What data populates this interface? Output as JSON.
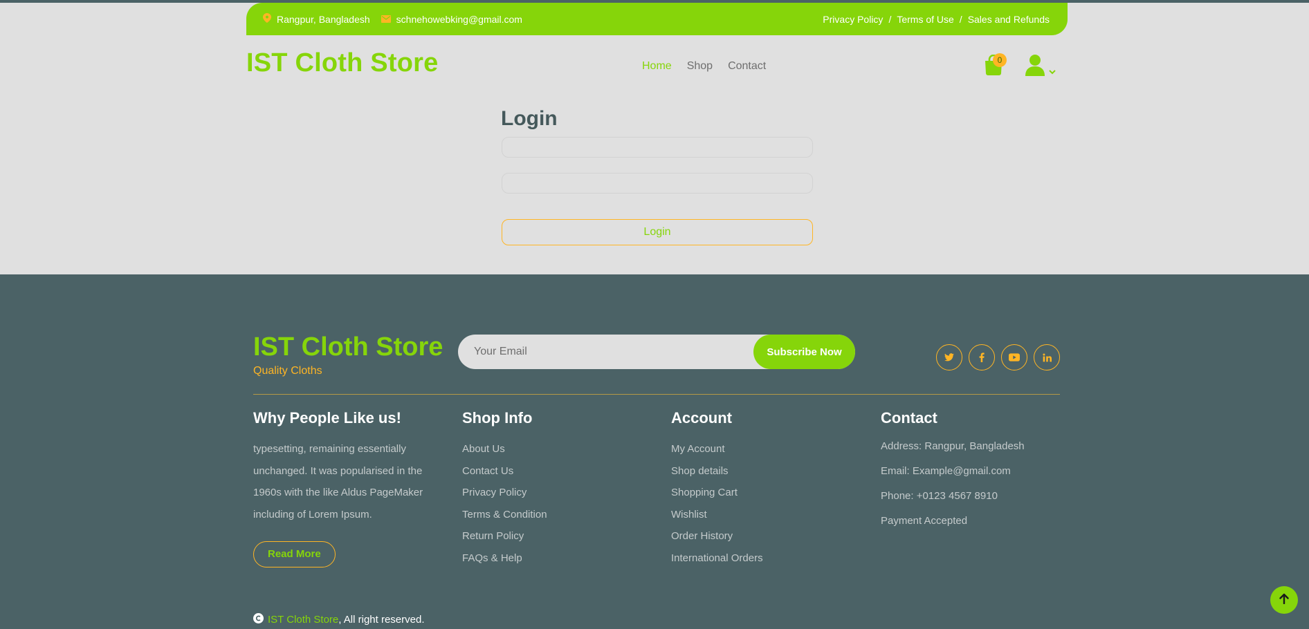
{
  "topbar": {
    "location": "Rangpur, Bangladesh",
    "email": "schnehowebking@gmail.com",
    "links": [
      "Privacy Policy",
      "Terms of Use",
      "Sales and Refunds"
    ],
    "separator": "/"
  },
  "header": {
    "brand": "IST Cloth Store",
    "nav": [
      "Home",
      "Shop",
      "Contact"
    ],
    "active_nav": "Home",
    "cart_count": "0",
    "icons": [
      "map-pin-icon",
      "envelope-icon",
      "shopping-bag-icon",
      "user-icon",
      "chevron-down-icon"
    ]
  },
  "login": {
    "title": "Login",
    "submit_label": "Login"
  },
  "footer": {
    "brand": "IST Cloth Store",
    "tagline": "Quality Cloths",
    "subscribe": {
      "placeholder": "Your Email",
      "button_label": "Subscribe Now"
    },
    "social_icons": [
      "twitter-icon",
      "facebook-icon",
      "youtube-icon",
      "linkedin-icon"
    ],
    "why": {
      "title": "Why People Like us!",
      "text": "typesetting, remaining essentially unchanged. It was popularised in the 1960s with the like Aldus PageMaker including of Lorem Ipsum.",
      "button_label": "Read More"
    },
    "shop_info": {
      "title": "Shop Info",
      "links": [
        "About Us",
        "Contact Us",
        "Privacy Policy",
        "Terms & Condition",
        "Return Policy",
        "FAQs & Help"
      ]
    },
    "account": {
      "title": "Account",
      "links": [
        "My Account",
        "Shop details",
        "Shopping Cart",
        "Wishlist",
        "Order History",
        "International Orders"
      ]
    },
    "contact": {
      "title": "Contact",
      "lines": [
        "Address: Rangpur, Bangladesh",
        "Email: Example@gmail.com",
        "Phone: +0123 4567 8910",
        "Payment Accepted"
      ]
    },
    "copyright": {
      "store": "IST Cloth Store",
      "suffix": ", All right reserved."
    }
  },
  "colors": {
    "primary": "#86d50a",
    "accent": "#ffb524",
    "footer_bg": "#4b6266",
    "page_bg": "#e0e0e0"
  }
}
